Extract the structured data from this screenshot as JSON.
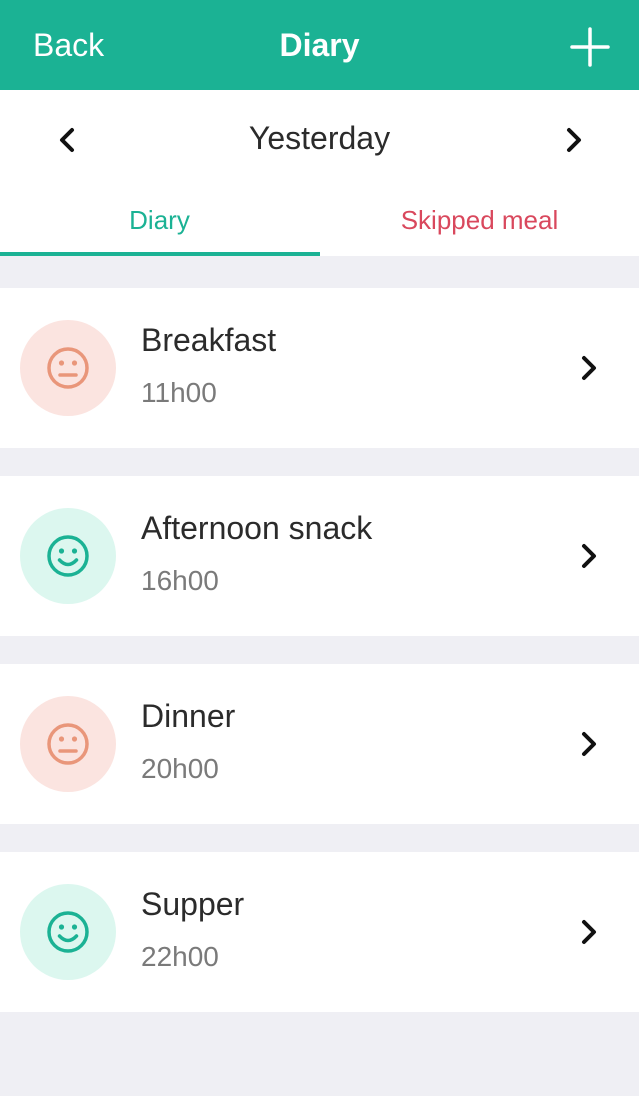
{
  "navbar": {
    "back_label": "Back",
    "title": "Diary"
  },
  "date_bar": {
    "label": "Yesterday"
  },
  "tabs": [
    {
      "label": "Diary",
      "active": true
    },
    {
      "label": "Skipped meal",
      "active": false
    }
  ],
  "colors": {
    "brand": "#1bb294",
    "alert": "#d9485d",
    "neutral_mood": "#e9967a",
    "neutral_mood_bg": "#fbe4e0",
    "happy_mood": "#1bb294",
    "happy_mood_bg": "#dcf7ef"
  },
  "meals": [
    {
      "name": "Breakfast",
      "time": "11h00",
      "mood": "neutral-face-icon"
    },
    {
      "name": "Afternoon snack",
      "time": "16h00",
      "mood": "smiley-face-icon"
    },
    {
      "name": "Dinner",
      "time": "20h00",
      "mood": "neutral-face-icon"
    },
    {
      "name": "Supper",
      "time": "22h00",
      "mood": "smiley-face-icon"
    }
  ]
}
